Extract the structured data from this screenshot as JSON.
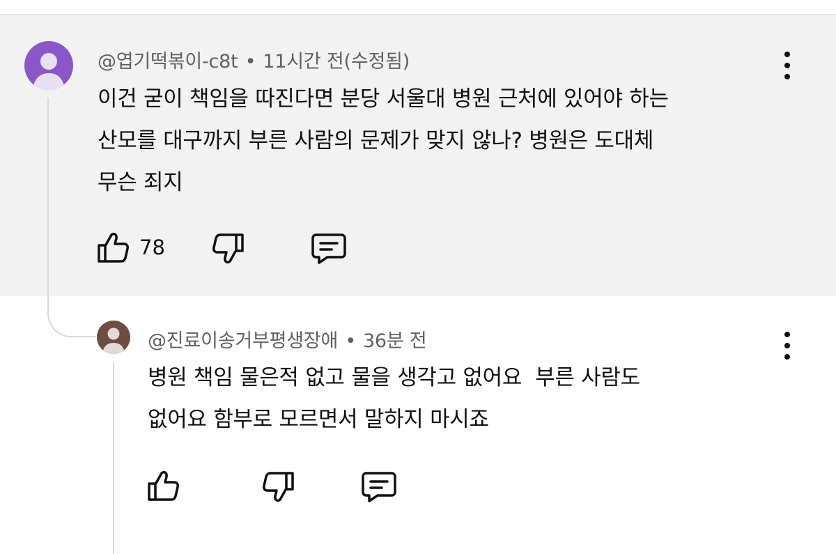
{
  "comments": [
    {
      "author": "@엽기떡볶이-c8t",
      "separator": "•",
      "time": "11시간 전(수정됨)",
      "text_lines": [
        "이건 굳이 책임을 따진다면 분당 서울대 병원 근처에 있어야 하는",
        "산모를 대구까지 부른 사람의 문제가 맞지 않나? 병원은 도대체",
        "무슨 죄지"
      ],
      "like_count": "78",
      "avatar_color": "#8a56c9"
    },
    {
      "author": "@진료이송거부평생장애",
      "separator": "•",
      "time": "36분 전",
      "text_lines": [
        "병원 책임 물은적 없고 물을 생각고 없어요  부른 사람도",
        "없어요 함부로 모르면서 말하지 마시죠"
      ],
      "like_count": "",
      "avatar_color": "#6d4c41"
    }
  ],
  "icons": {
    "like": "thumbs-up-icon",
    "dislike": "thumbs-down-icon",
    "reply": "comment-reply-icon",
    "more": "more-vertical-icon"
  },
  "colors": {
    "main_background": "#f2f2f2",
    "text": "#0f0f0f",
    "meta": "#606060"
  }
}
